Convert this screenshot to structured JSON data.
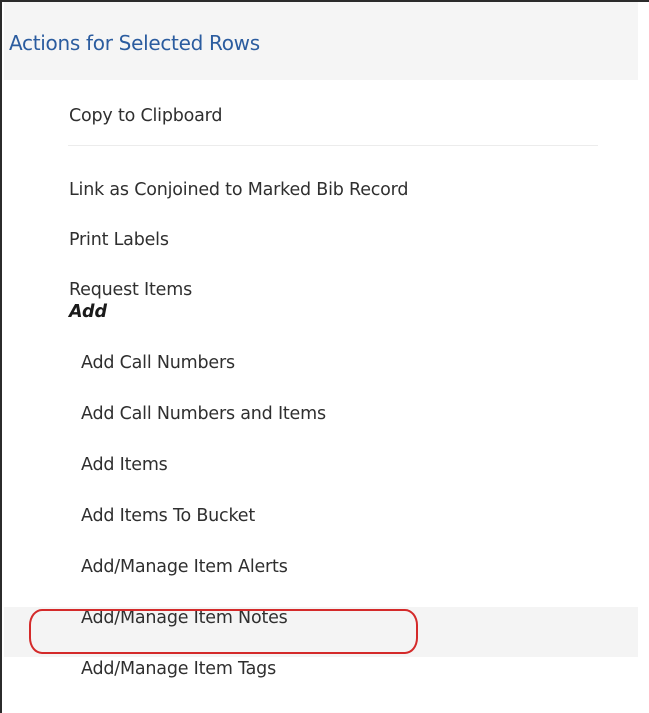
{
  "menu": {
    "title": "Actions for Selected Rows",
    "items": [
      {
        "label": "Copy to Clipboard"
      },
      {
        "label": "Link as Conjoined to Marked Bib Record"
      },
      {
        "label": "Print Labels"
      },
      {
        "label": "Request Items"
      }
    ],
    "section": {
      "label": "Add",
      "items": [
        {
          "label": "Add Call Numbers"
        },
        {
          "label": "Add Call Numbers and Items"
        },
        {
          "label": "Add Items"
        },
        {
          "label": "Add Items To Bucket"
        },
        {
          "label": "Add/Manage Item Alerts"
        },
        {
          "label": "Add/Manage Item Notes",
          "highlighted": true
        },
        {
          "label": "Add/Manage Item Tags"
        }
      ]
    }
  },
  "colors": {
    "title": "#2b5c9f",
    "highlight_circle": "#d42a2a",
    "header_bg": "#f5f5f5"
  }
}
